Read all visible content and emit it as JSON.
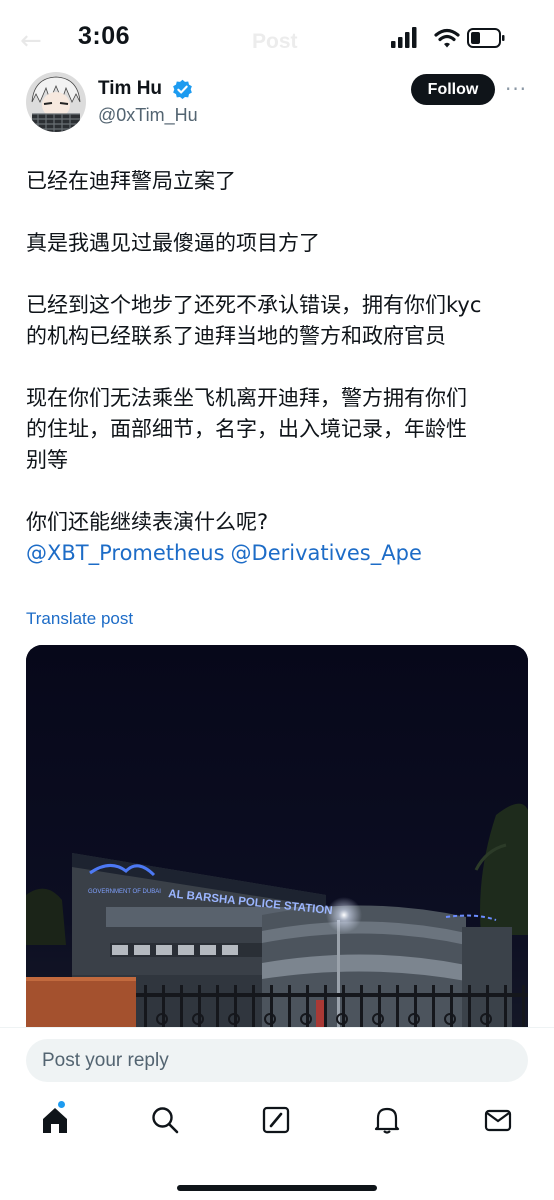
{
  "status_bar": {
    "time": "3:06"
  },
  "header": {
    "back_glyph": "←",
    "title": "Post"
  },
  "author": {
    "name": "Tim Hu",
    "handle": "@0xTim_Hu",
    "verified": true,
    "follow_label": "Follow",
    "more_glyph": "···"
  },
  "tweet": {
    "lines": [
      "已经在迪拜警局立案了",
      "真是我遇见过最傻逼的项目方了",
      "已经到这个地步了还死不承认错误，拥有你们kyc",
      "的机构已经联系了迪拜当地的警方和政府官员",
      "现在你们无法乘坐飞机离开迪拜，警方拥有你们",
      "的住址，面部细节，名字，出入境记录，年龄性",
      "别等",
      "你们还能继续表演什么呢?"
    ],
    "mentions": [
      "@XBT_Prometheus",
      "@Derivatives_Ape"
    ],
    "translate_label": "Translate post"
  },
  "photo": {
    "sign_text": "AL BARSHA POLICE STATION",
    "crest_text": "GOVERNMENT OF DUBAI",
    "night_color": "#0a0b18"
  },
  "reply": {
    "placeholder": "Post your reply"
  },
  "tabbar": {
    "icons": [
      "home-icon",
      "search-icon",
      "compose-icon",
      "notifications-icon",
      "messages-icon"
    ]
  },
  "colors": {
    "accent": "#1d9bf0",
    "link": "#1d6cc7",
    "text": "#0f1419",
    "secondary": "#536471"
  }
}
